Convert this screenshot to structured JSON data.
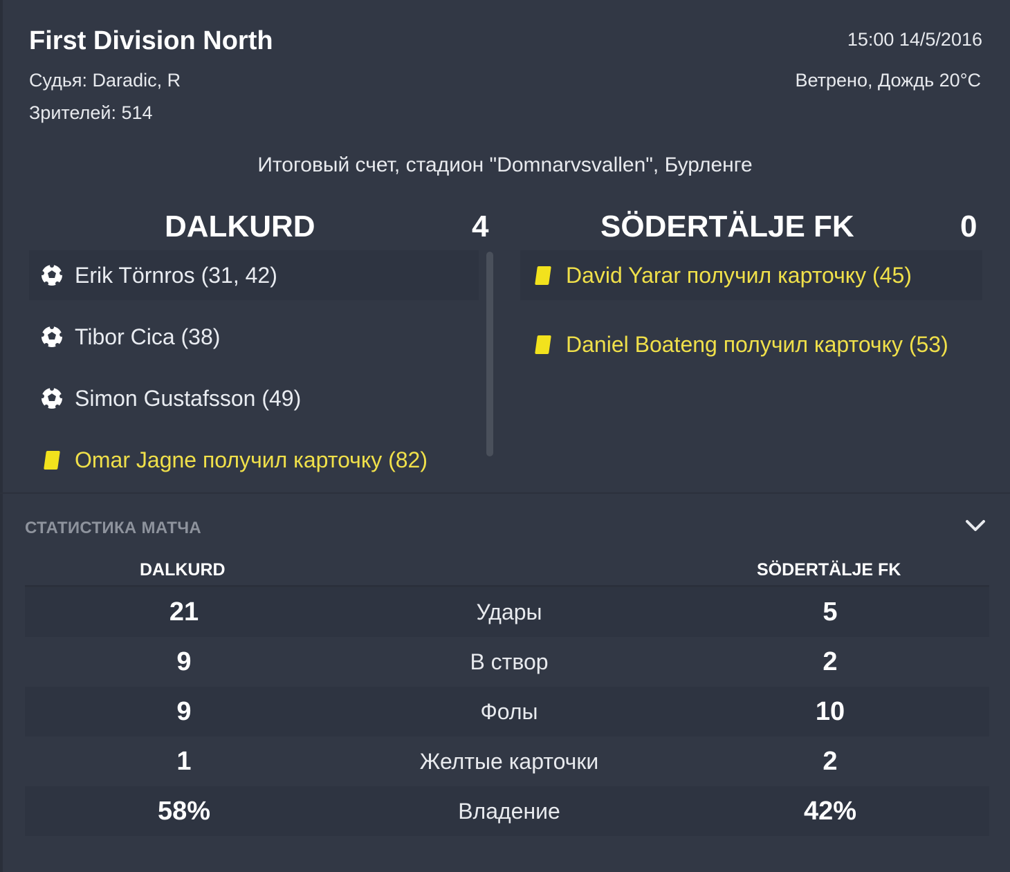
{
  "header": {
    "competition": "First Division North",
    "referee": "Судья: Daradic, R",
    "attendance": "Зрителей: 514",
    "datetime": "15:00 14/5/2016",
    "weather": "Ветрено, Дождь 20°C"
  },
  "result_label": "Итоговый счет, стадион \"Domnarvsvallen\", Бурленге",
  "home": {
    "name": "DALKURD",
    "score": "4",
    "events": [
      {
        "type": "goal",
        "icon": "football-icon",
        "text": "Erik Törnros (31, 42)"
      },
      {
        "type": "goal",
        "icon": "football-icon",
        "text": "Tibor Cica (38)"
      },
      {
        "type": "goal",
        "icon": "football-icon",
        "text": "Simon Gustafsson (49)"
      },
      {
        "type": "card",
        "icon": "yellow-card-icon",
        "text": "Omar Jagne получил карточку (82)"
      }
    ]
  },
  "away": {
    "name": "SÖDERTÄLJE FK",
    "score": "0",
    "events": [
      {
        "type": "card",
        "icon": "yellow-card-icon",
        "text": "David Yarar получил карточку (45)"
      },
      {
        "type": "card",
        "icon": "yellow-card-icon",
        "text": "Daniel Boateng получил карточку (53)"
      }
    ]
  },
  "stats": {
    "title": "СТАТИСТИКА МАТЧА",
    "toggle_icon": "chevron-down-icon",
    "home_label": "DALKURD",
    "away_label": "SÖDERTÄLJE FK",
    "rows": [
      {
        "label": "Удары",
        "home": "21",
        "away": "5"
      },
      {
        "label": "В створ",
        "home": "9",
        "away": "2"
      },
      {
        "label": "Фолы",
        "home": "9",
        "away": "10"
      },
      {
        "label": "Желтые карточки",
        "home": "1",
        "away": "2"
      },
      {
        "label": "Владение",
        "home": "58%",
        "away": "42%"
      }
    ]
  },
  "colors": {
    "background": "#323845",
    "card_text": "#f0e04a",
    "card_icon": "#f2e21d"
  }
}
